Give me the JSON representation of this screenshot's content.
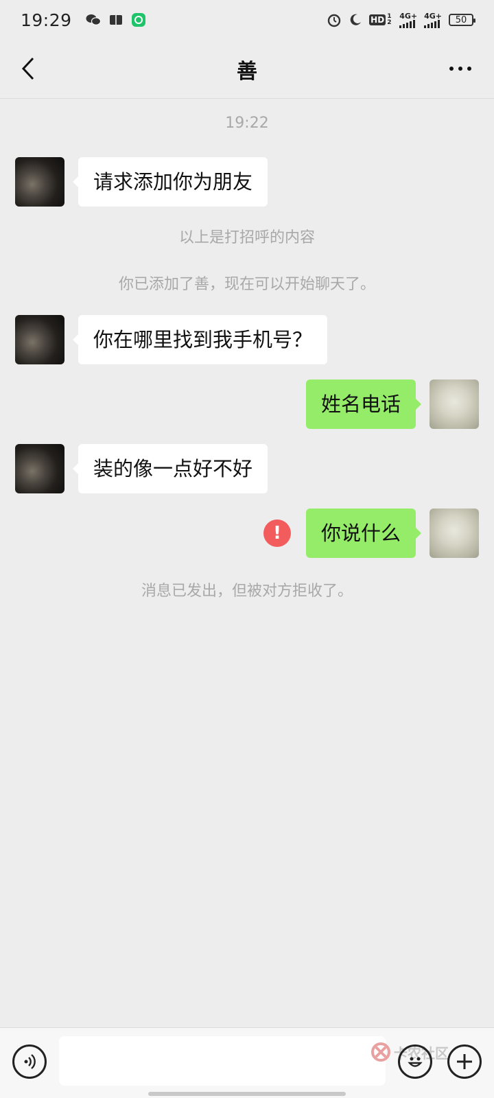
{
  "status_bar": {
    "time": "19:29",
    "hd_label": "HD",
    "hd_sub": "1 2",
    "net1": "4G+",
    "net2": "4G+",
    "battery": "50"
  },
  "header": {
    "title": "善"
  },
  "chat": {
    "timestamp": "19:22",
    "messages": [
      {
        "side": "in",
        "text": "请求添加你为朋友"
      },
      {
        "side": "in",
        "text": "你在哪里找到我手机号？"
      },
      {
        "side": "out",
        "text": "姓名电话"
      },
      {
        "side": "in",
        "text": "装的像一点好不好"
      },
      {
        "side": "out",
        "text": "你说什么",
        "failed": true
      }
    ],
    "system_greeting_note": "以上是打招呼的内容",
    "system_added_note": "你已添加了善，现在可以开始聊天了。",
    "system_rejected_note": "消息已发出，但被对方拒收了。",
    "error_mark": "!"
  },
  "input_bar": {
    "text_value": "",
    "watermark": "卡农社区"
  },
  "colors": {
    "background": "#ededed",
    "bubble_in": "#ffffff",
    "bubble_out": "#95ec69",
    "error": "#f25c5c",
    "system_text": "#a8a8a8"
  }
}
